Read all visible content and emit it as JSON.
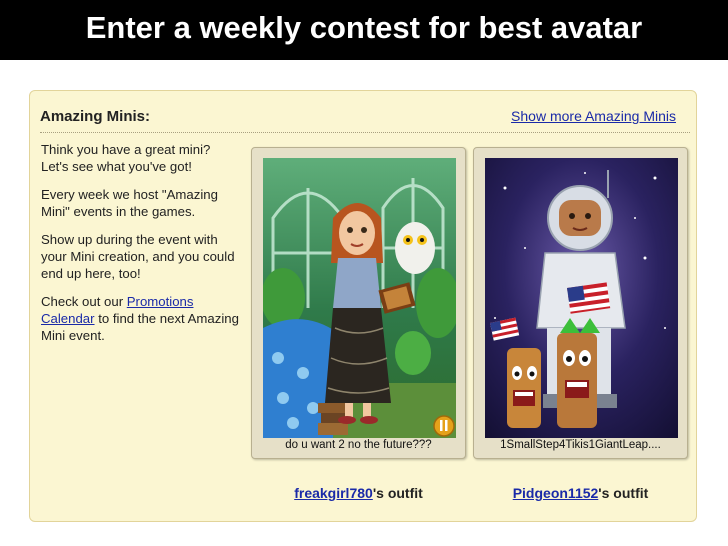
{
  "slide": {
    "title": "Enter a weekly contest for best avatar"
  },
  "panel": {
    "title": "Amazing Minis:",
    "show_more": "Show more Amazing Minis"
  },
  "intro": {
    "p1": "Think you have a great mini? Let's see what you've got!",
    "p2": "Every week we host \"Amazing Mini\" events in the games.",
    "p3": "Show up during the event with your Mini creation, and you could end up here, too!",
    "p4_before": "Check out our ",
    "p4_link": "Promotions Calendar",
    "p4_after": " to find the next Amazing Mini event."
  },
  "outfits": [
    {
      "caption": "do u want 2 no the future???",
      "owner": "freakgirl780",
      "owner_suffix": "'s outfit",
      "image": "fortune-teller-greenhouse-avatar"
    },
    {
      "caption": "1SmallStep4Tikis1GiantLeap....",
      "owner": "Pidgeon1152",
      "owner_suffix": "'s outfit",
      "image": "astronaut-tikis-space-avatar"
    }
  ],
  "colors": {
    "title_bar": "#000000",
    "panel_bg": "#fbf6d2",
    "link": "#1a2aa8"
  }
}
